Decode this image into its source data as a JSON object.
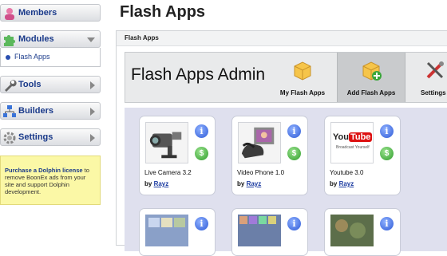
{
  "sidebar": {
    "items": [
      {
        "label": "Members",
        "icon": "users-icon"
      },
      {
        "label": "Modules",
        "icon": "puzzle-icon"
      },
      {
        "label": "Tools",
        "icon": "wrench-icon"
      },
      {
        "label": "Builders",
        "icon": "sitemap-icon"
      },
      {
        "label": "Settings",
        "icon": "gear-icon"
      }
    ],
    "submenu": {
      "label": "Flash Apps"
    },
    "promo": {
      "title": "Purchase a Dolphin license",
      "text": " to remove BoonEx ads from your site and support Dolphin development."
    }
  },
  "main": {
    "title": "Flash Apps",
    "panel_title": "Flash Apps",
    "admin_title": "Flash Apps Admin",
    "tabs": [
      {
        "label": "My Flash Apps",
        "icon": "box-icon"
      },
      {
        "label": "Add Flash Apps",
        "icon": "box-add-icon"
      },
      {
        "label": "Settings",
        "icon": "tools-icon"
      }
    ],
    "apps": [
      {
        "name": "Live Camera 3.2",
        "by": "by",
        "author": "Rayz"
      },
      {
        "name": "Video Phone 1.0",
        "by": "by",
        "author": "Rayz"
      },
      {
        "name": "Youtube 3.0",
        "by": "by",
        "author": "Rayz"
      }
    ],
    "youtube_logo": {
      "word1": "You",
      "word2": "Tube",
      "caption": "Broadcast Yourself"
    },
    "info_glyph": "i",
    "buy_glyph": "$"
  }
}
